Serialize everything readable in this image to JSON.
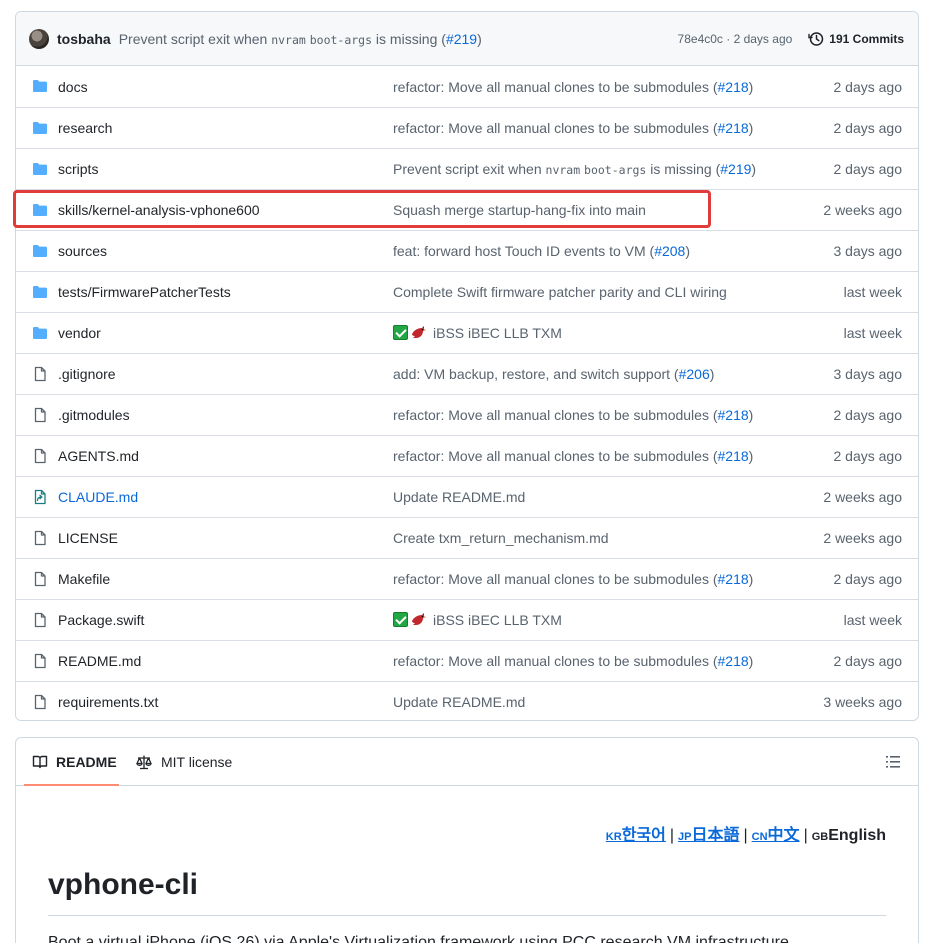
{
  "commit": {
    "author": "tosbaha",
    "message_prefix": "Prevent script exit when",
    "code1": "nvram",
    "code2": "boot-args",
    "message_suffix": "is missing (",
    "pr": "#219",
    "close": ")",
    "sha": "78e4c0c · 2 days ago",
    "commits_label": "191 Commits"
  },
  "files": [
    {
      "name": "docs",
      "type": "folder",
      "msg_pre": "refactor: Move all manual clones to be submodules (",
      "msg_link": "#218",
      "msg_post": ")",
      "age": "2 days ago"
    },
    {
      "name": "research",
      "type": "folder",
      "msg_pre": "refactor: Move all manual clones to be submodules (",
      "msg_link": "#218",
      "msg_post": ")",
      "age": "2 days ago"
    },
    {
      "name": "scripts",
      "type": "folder",
      "msg_pre": "Prevent script exit when",
      "msg_code1": "nvram",
      "msg_code2": "boot-args",
      "msg_mid": "is missing (",
      "msg_link": "#219",
      "msg_post": ")",
      "age": "2 days ago"
    },
    {
      "name": "skills/kernel-analysis-vphone600",
      "type": "folder",
      "msg_pre": "Squash merge startup-hang-fix into main",
      "age": "2 weeks ago"
    },
    {
      "name": "sources",
      "type": "folder",
      "msg_pre": "feat: forward host Touch ID events to VM (",
      "msg_link": "#208",
      "msg_post": ")",
      "age": "3 days ago"
    },
    {
      "name": "tests/FirmwarePatcherTests",
      "type": "folder",
      "msg_pre": "Complete Swift firmware patcher parity and CLI wiring",
      "age": "last week"
    },
    {
      "name": "vendor",
      "type": "folder",
      "msg_pre": "iBSS iBEC LLB TXM",
      "age": "last week"
    },
    {
      "name": ".gitignore",
      "type": "file",
      "msg_pre": "add: VM backup, restore, and switch support (",
      "msg_link": "#206",
      "msg_post": ")",
      "age": "3 days ago"
    },
    {
      "name": ".gitmodules",
      "type": "file",
      "msg_pre": "refactor: Move all manual clones to be submodules (",
      "msg_link": "#218",
      "msg_post": ")",
      "age": "2 days ago"
    },
    {
      "name": "AGENTS.md",
      "type": "file",
      "msg_pre": "refactor: Move all manual clones to be submodules (",
      "msg_link": "#218",
      "msg_post": ")",
      "age": "2 days ago"
    },
    {
      "name": "CLAUDE.md",
      "type": "symlink",
      "msg_pre": "Update README.md",
      "age": "2 weeks ago"
    },
    {
      "name": "LICENSE",
      "type": "file",
      "msg_pre": "Create txm_return_mechanism.md",
      "age": "2 weeks ago"
    },
    {
      "name": "Makefile",
      "type": "file",
      "msg_pre": "refactor: Move all manual clones to be submodules (",
      "msg_link": "#218",
      "msg_post": ")",
      "age": "2 days ago"
    },
    {
      "name": "Package.swift",
      "type": "file",
      "msg_pre": "iBSS iBEC LLB TXM",
      "age": "last week"
    },
    {
      "name": "README.md",
      "type": "file",
      "msg_pre": "refactor: Move all manual clones to be submodules (",
      "msg_link": "#218",
      "msg_post": ")",
      "age": "2 days ago"
    },
    {
      "name": "requirements.txt",
      "type": "file",
      "msg_pre": "Update README.md",
      "age": "3 weeks ago"
    }
  ],
  "readme": {
    "tab_readme": "README",
    "tab_license": "MIT license",
    "langs": [
      {
        "code": "KR",
        "label": "한국어"
      },
      {
        "code": "JP",
        "label": "日本語"
      },
      {
        "code": "CN",
        "label": "中文"
      },
      {
        "code": "GB",
        "label": "English"
      }
    ],
    "separator": "|",
    "title": "vphone-cli",
    "body_line": "Boot a virtual iPhone (iOS 26) via Apple's Virtualization.framework using PCC research VM infrastructure."
  },
  "colors": {
    "link": "#0969da",
    "folder": "#54aeff",
    "highlight": "#e03c3c",
    "tab_underline": "#fd8c73"
  }
}
